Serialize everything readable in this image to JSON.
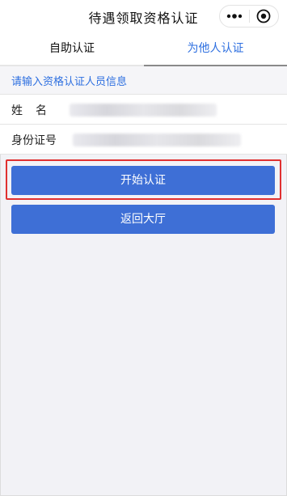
{
  "header": {
    "title": "待遇领取资格认证",
    "more_icon": "ellipsis-icon",
    "close_icon": "target-circle-icon"
  },
  "tabs": [
    {
      "label": "自助认证",
      "active": false
    },
    {
      "label": "为他人认证",
      "active": true
    }
  ],
  "form": {
    "section_title": "请输入资格认证人员信息",
    "name_label": "姓名",
    "name_value": "",
    "id_label": "身份证号",
    "id_value": ""
  },
  "buttons": {
    "start": "开始认证",
    "back": "返回大厅"
  },
  "colors": {
    "accent": "#2d6fe0",
    "button": "#3e6fd6",
    "highlight_border": "#e03030",
    "background": "#f2f2f6"
  }
}
